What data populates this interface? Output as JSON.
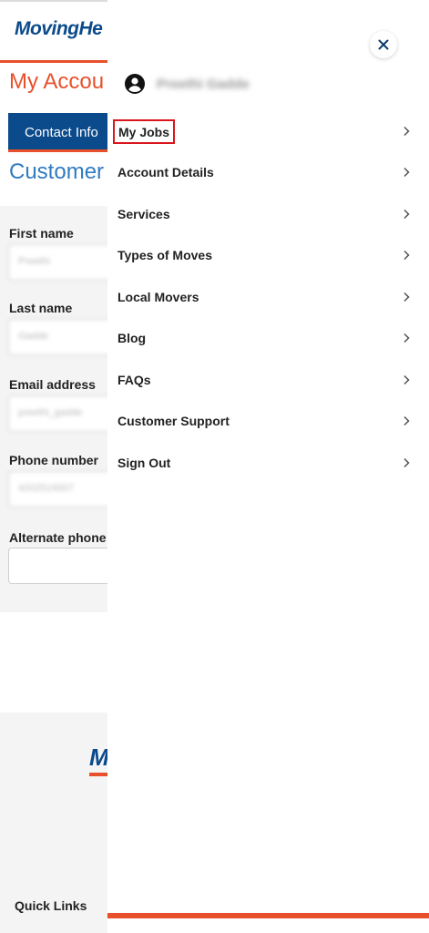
{
  "header": {
    "logo_text": "MovingHe",
    "page_title": "My Accou",
    "contact_tab_label": "Contact Info",
    "section_title": "Customer"
  },
  "form": {
    "fields": [
      {
        "label": "First name",
        "value": "Preethi"
      },
      {
        "label": "Last name",
        "value": "Gadde"
      },
      {
        "label": "Email address",
        "value": "preethi_gadde"
      },
      {
        "label": "Phone number",
        "value": "4202519007"
      },
      {
        "label": "Alternate phone n",
        "value": ""
      }
    ]
  },
  "footer": {
    "logo_text": "M",
    "quick_links": "Quick Links"
  },
  "drawer": {
    "close_icon": "close-icon",
    "user_icon": "account-circle-icon",
    "user_name": "Preethi Gadde",
    "menu": [
      {
        "label": "My Jobs",
        "highlighted": true
      },
      {
        "label": "Account Details"
      },
      {
        "label": "Services"
      },
      {
        "label": "Types of Moves"
      },
      {
        "label": "Local Movers"
      },
      {
        "label": "Blog"
      },
      {
        "label": "FAQs"
      },
      {
        "label": "Customer Support"
      },
      {
        "label": "Sign Out"
      }
    ]
  },
  "colors": {
    "brand_blue": "#0b4a8b",
    "accent_orange": "#e8502b",
    "section_blue": "#2f7bbf",
    "highlight_red": "#d9161c"
  }
}
